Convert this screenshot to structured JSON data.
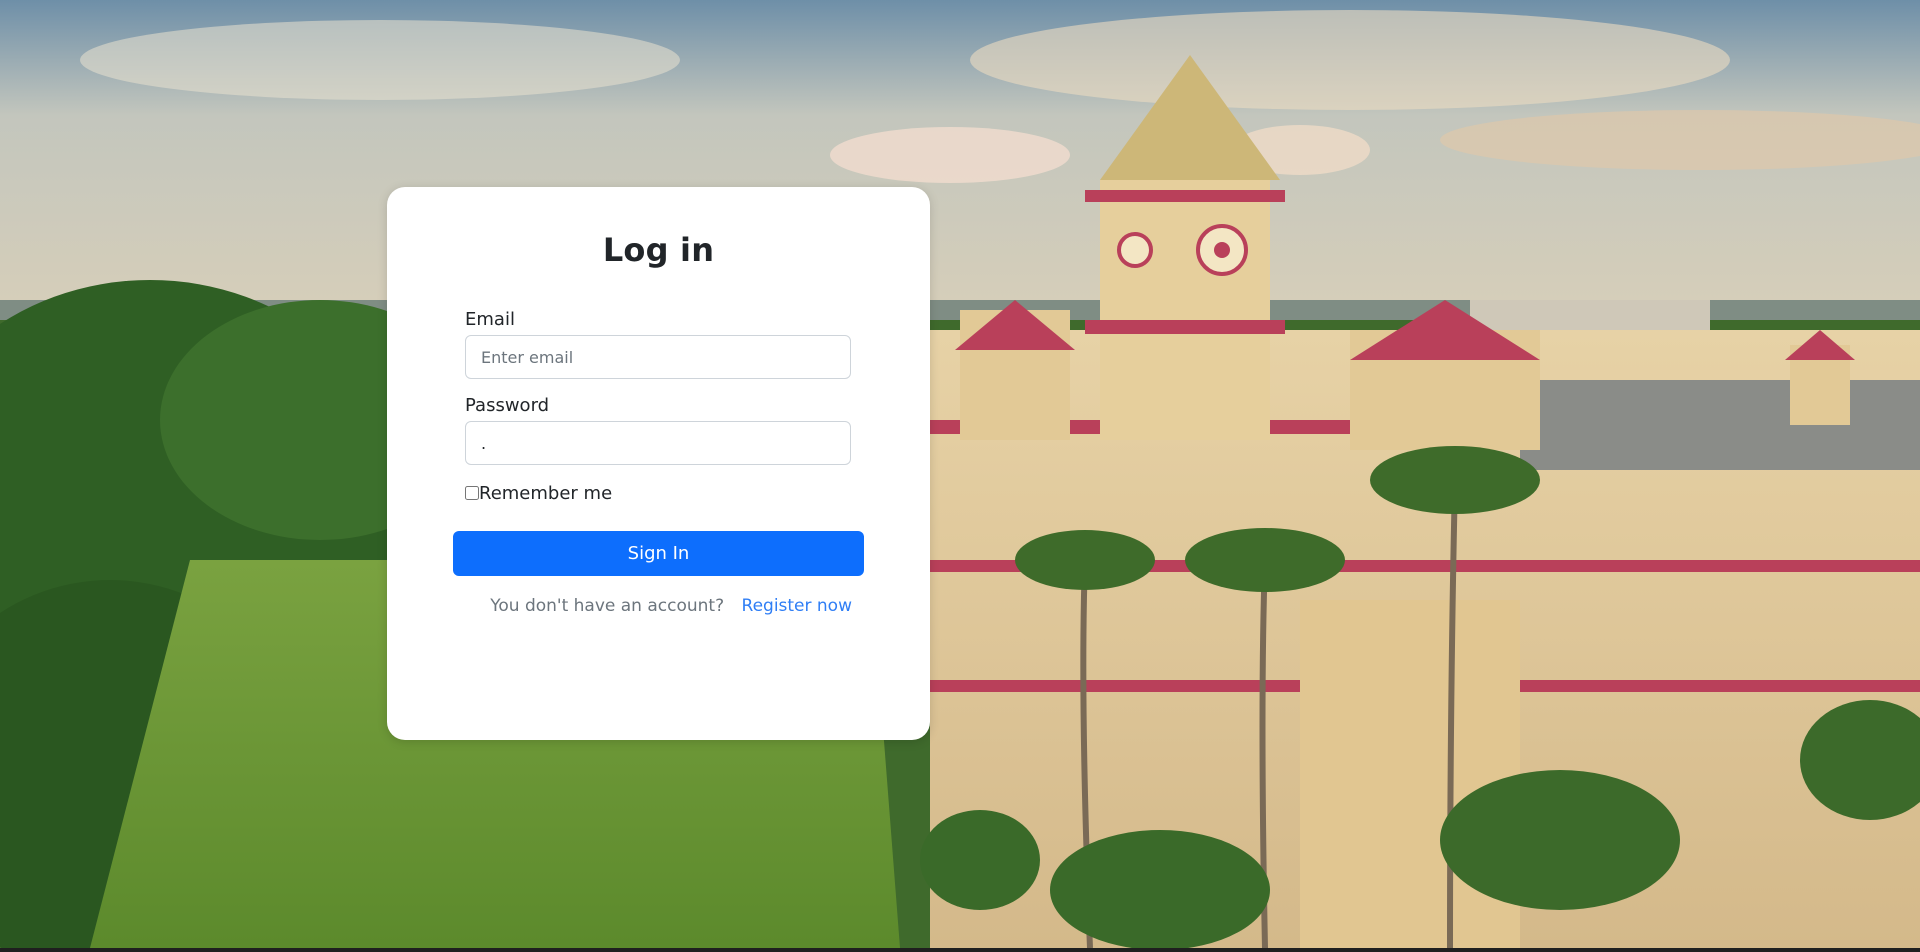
{
  "login": {
    "title": "Log in",
    "email_label": "Email",
    "email_placeholder": "Enter email",
    "email_value": "",
    "password_label": "Password",
    "password_value": ".",
    "remember_label": "Remember me",
    "signin_label": "Sign In",
    "register_prompt": "You don't have an account?",
    "register_link": "Register now"
  },
  "colors": {
    "primary": "#0d6efd",
    "link": "#2f7ef5",
    "card": "#ffffff"
  }
}
